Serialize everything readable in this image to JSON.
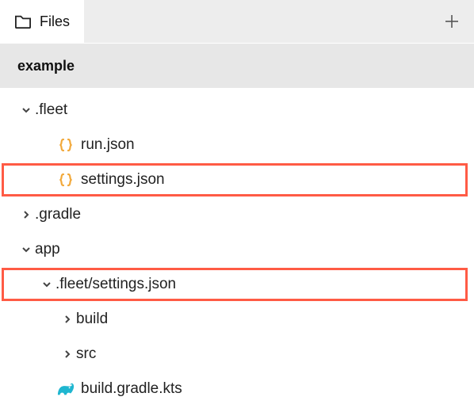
{
  "header": {
    "tab_label": "Files"
  },
  "root": {
    "name": "example"
  },
  "tree": {
    "fleet": {
      "name": ".fleet",
      "expanded": true,
      "children": {
        "run": {
          "name": "run.json"
        },
        "settings": {
          "name": "settings.json"
        }
      }
    },
    "gradle": {
      "name": ".gradle",
      "expanded": false
    },
    "app": {
      "name": "app",
      "expanded": true,
      "children": {
        "fleet_settings": {
          "name": ".fleet/settings.json",
          "expanded": true
        },
        "build": {
          "name": "build",
          "expanded": false
        },
        "src": {
          "name": "src",
          "expanded": false
        },
        "build_gradle": {
          "name": "build.gradle.kts"
        }
      }
    }
  },
  "colors": {
    "highlight": "#ff5b45",
    "json_icon": "#f2a93b",
    "gradle_icon": "#1fb6d0"
  }
}
